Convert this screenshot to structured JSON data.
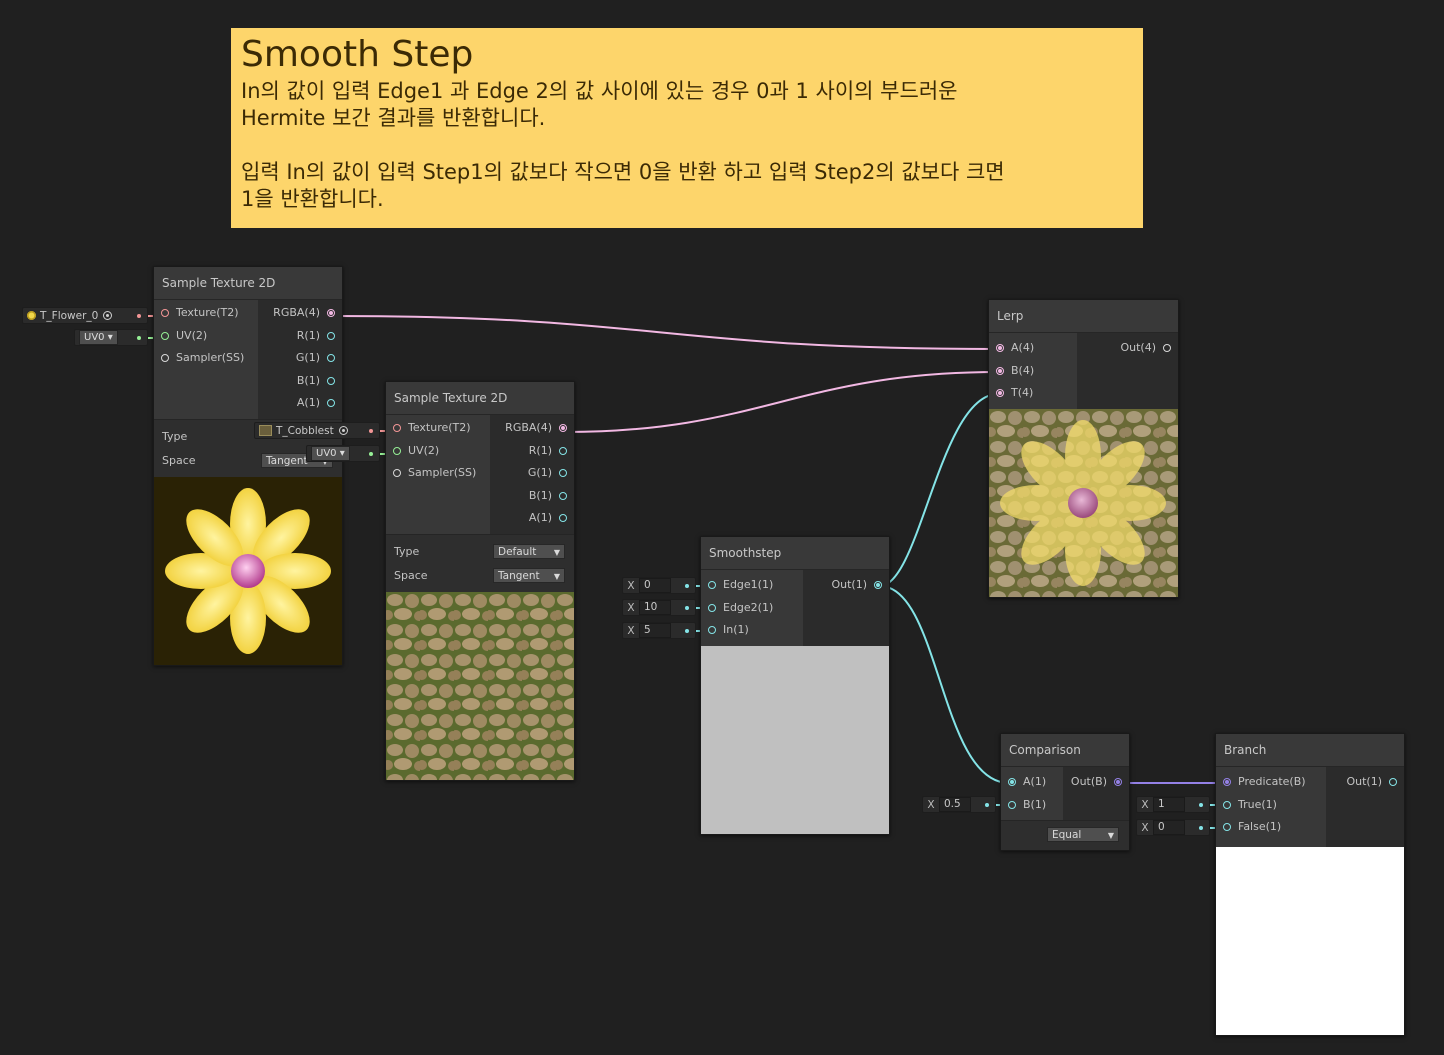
{
  "sticky_note": {
    "title": "Smooth Step",
    "body": "In의 값이 입력 Edge1 과 Edge 2의 값 사이에 있는 경우 0과 1 사이의 부드러운\nHermite 보간 결과를 반환합니다.\n\n입력 In의 값이 입력 Step1의 값보다 작으면 0을 반환 하고 입력 Step2의 값보다 크면\n1을 반환합니다."
  },
  "colors": {
    "texture_port": "#f39696",
    "uv_port": "#96f096",
    "vector4_port": "#f2b8e3",
    "vector1_port": "#84e4e7",
    "boolean_port": "#9481e6",
    "sticky_bg": "#fdd56b"
  },
  "sample_texture_1": {
    "title": "Sample Texture 2D",
    "inputs": [
      "Texture(T2)",
      "UV(2)",
      "Sampler(SS)"
    ],
    "outputs": [
      "RGBA(4)",
      "R(1)",
      "G(1)",
      "B(1)",
      "A(1)"
    ],
    "type_label": "Type",
    "space_label": "Space",
    "space_value": "Tangent",
    "texture_asset": "T_Flower_0",
    "uv_value": "UV0",
    "preview_icon": "flower-texture-preview"
  },
  "sample_texture_2": {
    "title": "Sample Texture 2D",
    "inputs": [
      "Texture(T2)",
      "UV(2)",
      "Sampler(SS)"
    ],
    "outputs": [
      "RGBA(4)",
      "R(1)",
      "G(1)",
      "B(1)",
      "A(1)"
    ],
    "type_label": "Type",
    "type_value": "Default",
    "space_label": "Space",
    "space_value": "Tangent",
    "texture_asset": "T_Cobblest",
    "uv_value": "UV0",
    "preview_icon": "cobblestone-texture-preview"
  },
  "lerp": {
    "title": "Lerp",
    "inputs": [
      "A(4)",
      "B(4)",
      "T(4)"
    ],
    "outputs": [
      "Out(4)"
    ],
    "preview_icon": "blended-texture-preview"
  },
  "smoothstep": {
    "title": "Smoothstep",
    "inputs": [
      "Edge1(1)",
      "Edge2(1)",
      "In(1)"
    ],
    "outputs": [
      "Out(1)"
    ],
    "edge1": "0",
    "edge2": "10",
    "in": "5",
    "x_label": "X"
  },
  "comparison": {
    "title": "Comparison",
    "inputs": [
      "A(1)",
      "B(1)"
    ],
    "outputs": [
      "Out(B)"
    ],
    "b_value": "0.5",
    "mode": "Equal",
    "x_label": "X"
  },
  "branch": {
    "title": "Branch",
    "inputs": [
      "Predicate(B)",
      "True(1)",
      "False(1)"
    ],
    "outputs": [
      "Out(1)"
    ],
    "true_value": "1",
    "false_value": "0",
    "x_label": "X"
  }
}
